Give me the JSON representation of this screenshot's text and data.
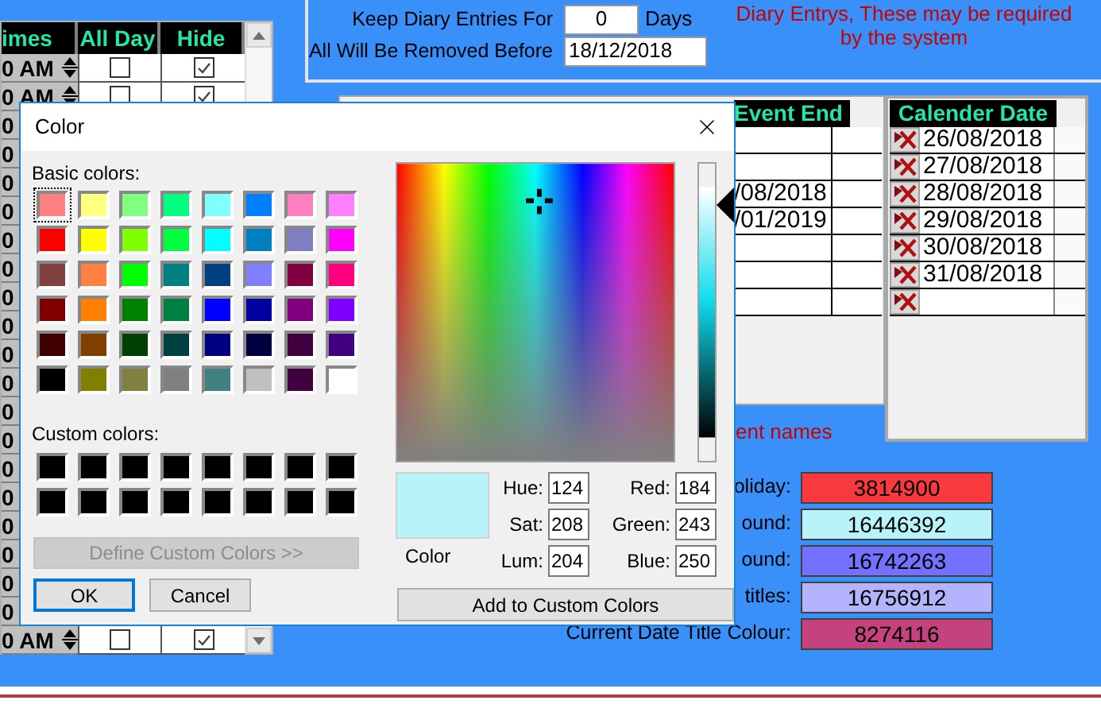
{
  "time_grid": {
    "columns": [
      "imes",
      "All Day",
      "Hide"
    ],
    "rows": [
      {
        "kind": "full",
        "time": "0 AM",
        "all_day": false,
        "hide": true
      },
      {
        "kind": "full",
        "time": "0 AM",
        "all_day": false,
        "hide": true
      },
      {
        "kind": "covered",
        "time": "0"
      },
      {
        "kind": "covered",
        "time": "0"
      },
      {
        "kind": "covered",
        "time": "0"
      },
      {
        "kind": "covered",
        "time": "0"
      },
      {
        "kind": "covered",
        "time": "0"
      },
      {
        "kind": "covered",
        "time": "0"
      },
      {
        "kind": "covered",
        "time": "0"
      },
      {
        "kind": "covered",
        "time": "0"
      },
      {
        "kind": "covered",
        "time": "0"
      },
      {
        "kind": "covered",
        "time": "0"
      },
      {
        "kind": "covered",
        "time": "0"
      },
      {
        "kind": "covered",
        "time": "0"
      },
      {
        "kind": "covered",
        "time": "0"
      },
      {
        "kind": "covered",
        "time": "0"
      },
      {
        "kind": "covered",
        "time": "0"
      },
      {
        "kind": "covered",
        "time": "0"
      },
      {
        "kind": "covered",
        "time": "0"
      },
      {
        "kind": "covered",
        "time": "0"
      },
      {
        "kind": "full",
        "time": "0 AM",
        "all_day": false,
        "hide": true
      }
    ]
  },
  "settings": {
    "keep_label": "Keep Diary Entries For",
    "keep_value": "0",
    "keep_unit": "Days",
    "remove_label": "All Will Be Removed Before",
    "remove_value": "18/12/2018",
    "warning": [
      "Diary Entrys, These may be required",
      "by the system"
    ]
  },
  "event_grid": {
    "header": "Event End",
    "rows": [
      {},
      {},
      {
        "end": "/08/2018"
      },
      {
        "end": "/01/2019"
      },
      {},
      {},
      {}
    ]
  },
  "calendar": {
    "header": "Calender Date",
    "rows": [
      {
        "date": "26/08/2018"
      },
      {
        "date": "27/08/2018"
      },
      {
        "date": "28/08/2018"
      },
      {
        "date": "29/08/2018"
      },
      {
        "date": "30/08/2018"
      },
      {
        "date": "31/08/2018"
      },
      {}
    ]
  },
  "colours": {
    "note": "ent names",
    "items": [
      {
        "label": "oliday:",
        "value": "3814900",
        "color": "#f83a3f"
      },
      {
        "label": "ound:",
        "value": "16446392",
        "color": "#b8f3fa"
      },
      {
        "label": "ound:",
        "value": "16742263",
        "color": "#7272fe"
      },
      {
        "label": "titles:",
        "value": "16756912",
        "color": "#b4b4fe"
      },
      {
        "label": "Current Date Title Colour:",
        "value": "8274116",
        "color": "#c4427e"
      }
    ]
  },
  "dialog": {
    "title": "Color",
    "basic_label": "Basic colors:",
    "basic_colors": [
      {
        "color": "#ff8080",
        "selected": true
      },
      {
        "color": "#ffff80",
        "selected": false
      },
      {
        "color": "#80ff80",
        "selected": false
      },
      {
        "color": "#00ff80",
        "selected": false
      },
      {
        "color": "#80ffff",
        "selected": false
      },
      {
        "color": "#0080ff",
        "selected": false
      },
      {
        "color": "#ff80c0",
        "selected": false
      },
      {
        "color": "#ff80ff",
        "selected": false
      },
      {
        "color": "#ff0000",
        "selected": false
      },
      {
        "color": "#ffff00",
        "selected": false
      },
      {
        "color": "#80ff00",
        "selected": false
      },
      {
        "color": "#00ff40",
        "selected": false
      },
      {
        "color": "#00ffff",
        "selected": false
      },
      {
        "color": "#0080c0",
        "selected": false
      },
      {
        "color": "#8080c0",
        "selected": false
      },
      {
        "color": "#ff00ff",
        "selected": false
      },
      {
        "color": "#804040",
        "selected": false
      },
      {
        "color": "#ff8040",
        "selected": false
      },
      {
        "color": "#00ff00",
        "selected": false
      },
      {
        "color": "#008080",
        "selected": false
      },
      {
        "color": "#004080",
        "selected": false
      },
      {
        "color": "#8080ff",
        "selected": false
      },
      {
        "color": "#800040",
        "selected": false
      },
      {
        "color": "#ff0080",
        "selected": false
      },
      {
        "color": "#800000",
        "selected": false
      },
      {
        "color": "#ff8000",
        "selected": false
      },
      {
        "color": "#008000",
        "selected": false
      },
      {
        "color": "#008040",
        "selected": false
      },
      {
        "color": "#0000ff",
        "selected": false
      },
      {
        "color": "#0000a0",
        "selected": false
      },
      {
        "color": "#800080",
        "selected": false
      },
      {
        "color": "#8000ff",
        "selected": false
      },
      {
        "color": "#400000",
        "selected": false
      },
      {
        "color": "#804000",
        "selected": false
      },
      {
        "color": "#004000",
        "selected": false
      },
      {
        "color": "#004040",
        "selected": false
      },
      {
        "color": "#000080",
        "selected": false
      },
      {
        "color": "#000040",
        "selected": false
      },
      {
        "color": "#400040",
        "selected": false
      },
      {
        "color": "#400080",
        "selected": false
      },
      {
        "color": "#000000",
        "selected": false
      },
      {
        "color": "#808000",
        "selected": false
      },
      {
        "color": "#808040",
        "selected": false
      },
      {
        "color": "#808080",
        "selected": false
      },
      {
        "color": "#408080",
        "selected": false
      },
      {
        "color": "#c0c0c0",
        "selected": false
      },
      {
        "color": "#400040",
        "selected": false
      },
      {
        "color": "#ffffff",
        "selected": false
      }
    ],
    "custom_label": "Custom colors:",
    "custom_colors": [
      {
        "color": "#000000",
        "selected": false
      },
      {
        "color": "#000000",
        "selected": false
      },
      {
        "color": "#000000",
        "selected": false
      },
      {
        "color": "#000000",
        "selected": false
      },
      {
        "color": "#000000",
        "selected": false
      },
      {
        "color": "#000000",
        "selected": false
      },
      {
        "color": "#000000",
        "selected": false
      },
      {
        "color": "#000000",
        "selected": false
      },
      {
        "color": "#000000",
        "selected": false
      },
      {
        "color": "#000000",
        "selected": false
      },
      {
        "color": "#000000",
        "selected": false
      },
      {
        "color": "#000000",
        "selected": false
      },
      {
        "color": "#000000",
        "selected": false
      },
      {
        "color": "#000000",
        "selected": false
      },
      {
        "color": "#000000",
        "selected": false
      },
      {
        "color": "#000000",
        "selected": false
      }
    ],
    "define_button": {
      "label": "Define Custom Colors >>",
      "disabled": true
    },
    "buttons": [
      {
        "label": "OK",
        "default": true
      },
      {
        "label": "Cancel",
        "default": false
      }
    ],
    "preview": {
      "label": "Color",
      "color": "#b8f3fa"
    },
    "fields": [
      {
        "label": "Hue:",
        "value": "124"
      },
      {
        "label": "Sat:",
        "value": "208"
      },
      {
        "label": "Lum:",
        "value": "204"
      },
      {
        "label": "Red:",
        "value": "184"
      },
      {
        "label": "Green:",
        "value": "243"
      },
      {
        "label": "Blue:",
        "value": "250"
      }
    ],
    "add_button": "Add to Custom Colors"
  }
}
